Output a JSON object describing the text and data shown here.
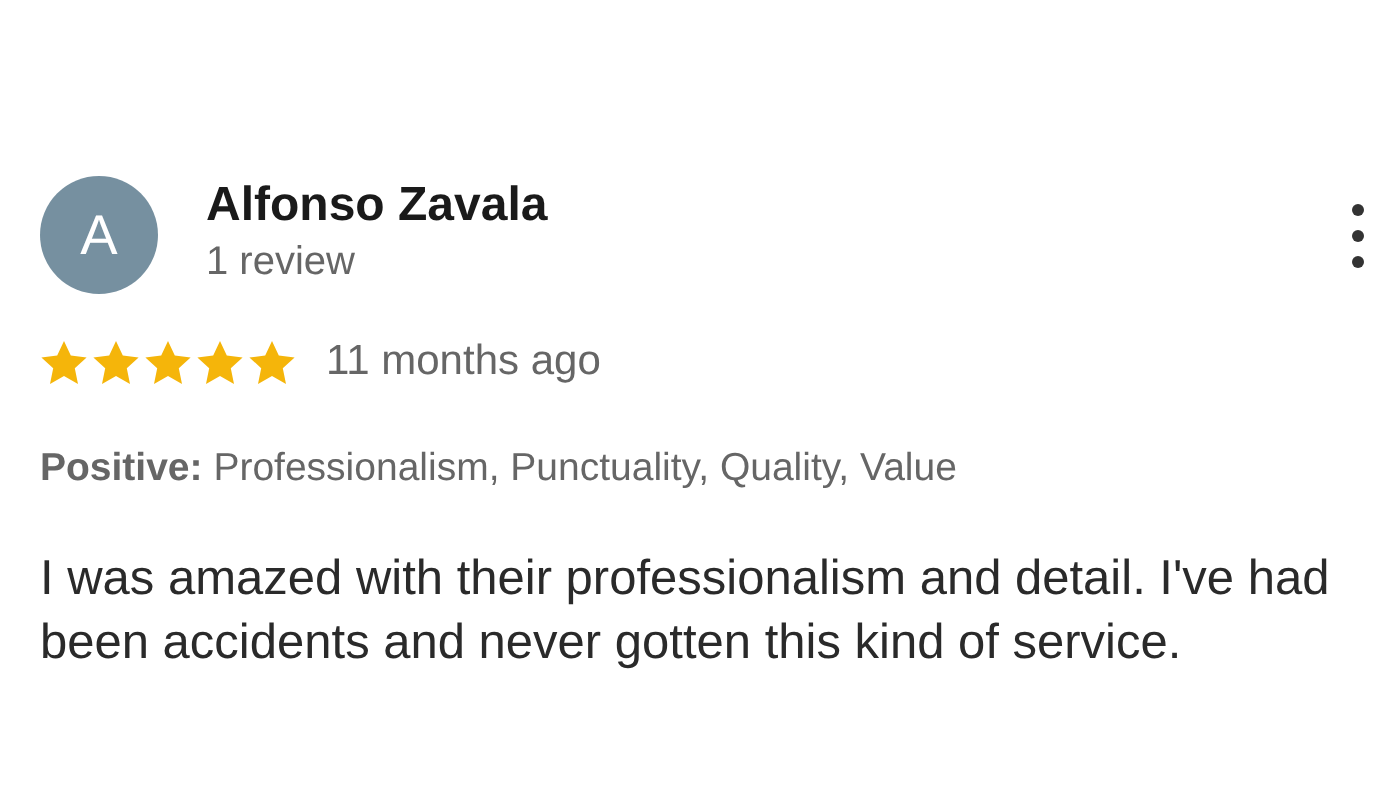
{
  "review": {
    "avatar_letter": "A",
    "author": "Alfonso Zavala",
    "review_count": "1 review",
    "stars": 5,
    "time": "11 months ago",
    "highlights": "**Positive:** Professionalism, Punctuality, Quality, Value",
    "text": "I was amazed with their professionalism and detail. I've had been accidents and never gotten this kind of service."
  }
}
